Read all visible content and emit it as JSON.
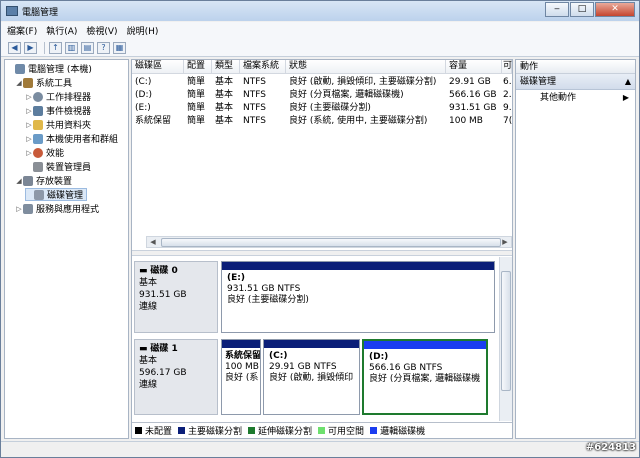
{
  "window": {
    "title": "電腦管理"
  },
  "menu": [
    "檔案(F)",
    "執行(A)",
    "檢視(V)",
    "說明(H)"
  ],
  "tree": [
    {
      "label": "電腦管理 (本機)",
      "level": 0,
      "icon": "computer-icon",
      "toggle": ""
    },
    {
      "label": "系統工具",
      "level": 1,
      "icon": "tools-icon",
      "toggle": "◢"
    },
    {
      "label": "工作排程器",
      "level": 2,
      "icon": "clock-icon",
      "toggle": "▷"
    },
    {
      "label": "事件檢視器",
      "level": 2,
      "icon": "event-log-icon",
      "toggle": "▷"
    },
    {
      "label": "共用資料夾",
      "level": 2,
      "icon": "shared-folder-icon",
      "toggle": "▷"
    },
    {
      "label": "本機使用者和群組",
      "level": 2,
      "icon": "users-icon",
      "toggle": "▷"
    },
    {
      "label": "效能",
      "level": 2,
      "icon": "performance-icon",
      "toggle": "▷"
    },
    {
      "label": "裝置管理員",
      "level": 2,
      "icon": "device-manager-icon",
      "toggle": ""
    },
    {
      "label": "存放裝置",
      "level": 1,
      "icon": "storage-icon",
      "toggle": "◢"
    },
    {
      "label": "磁碟管理",
      "level": 2,
      "icon": "disk-management-icon",
      "toggle": "",
      "selected": true
    },
    {
      "label": "服務與應用程式",
      "level": 1,
      "icon": "services-icon",
      "toggle": "▷"
    }
  ],
  "volumes": {
    "headers": [
      "磁碟區",
      "配置",
      "類型",
      "檔案系統",
      "狀態",
      "容量",
      "可"
    ],
    "rows": [
      [
        "(C:)",
        "簡單",
        "基本",
        "NTFS",
        "良好 (啟動, 損毀傾印, 主要磁碟分割)",
        "29.91 GB",
        "6."
      ],
      [
        "(D:)",
        "簡單",
        "基本",
        "NTFS",
        "良好 (分頁檔案, 邏輯磁碟機)",
        "566.16 GB",
        "2."
      ],
      [
        "(E:)",
        "簡單",
        "基本",
        "NTFS",
        "良好 (主要磁碟分割)",
        "931.51 GB",
        "9."
      ],
      [
        "系統保留",
        "簡單",
        "基本",
        "NTFS",
        "良好 (系統, 使用中, 主要磁碟分割)",
        "100 MB",
        "7("
      ]
    ]
  },
  "disks": [
    {
      "name": "磁碟 0",
      "type": "基本",
      "size": "931.51 GB",
      "status": "連線",
      "partitions": [
        {
          "name": "(E:)",
          "size": "931.51 GB NTFS",
          "status": "良好 (主要磁碟分割)"
        }
      ]
    },
    {
      "name": "磁碟 1",
      "type": "基本",
      "size": "596.17 GB",
      "status": "連線",
      "partitions": [
        {
          "name": "系統保留",
          "size": "100 MB",
          "status": "良好 (系"
        },
        {
          "name": "(C:)",
          "size": "29.91 GB NTFS",
          "status": "良好 (啟動, 損毀傾印"
        },
        {
          "name": "(D:)",
          "size": "566.16 GB NTFS",
          "status": "良好 (分頁檔案, 邏輯磁碟機"
        }
      ]
    }
  ],
  "legend": [
    {
      "label": "未配置",
      "color": "#000000"
    },
    {
      "label": "主要磁碟分割",
      "color": "#0a1e78"
    },
    {
      "label": "延伸磁碟分割",
      "color": "#1e7a2e"
    },
    {
      "label": "可用空間",
      "color": "#6ee06e"
    },
    {
      "label": "邏輯磁碟機",
      "color": "#1a3cf0"
    }
  ],
  "actions": {
    "header": "動作",
    "section": "磁碟管理",
    "item": "其他動作"
  },
  "watermark": "#624813",
  "colors": {
    "primary": "#0a1e78",
    "logical": "#1a3cf0",
    "selected_border": "#1e7a2e"
  }
}
